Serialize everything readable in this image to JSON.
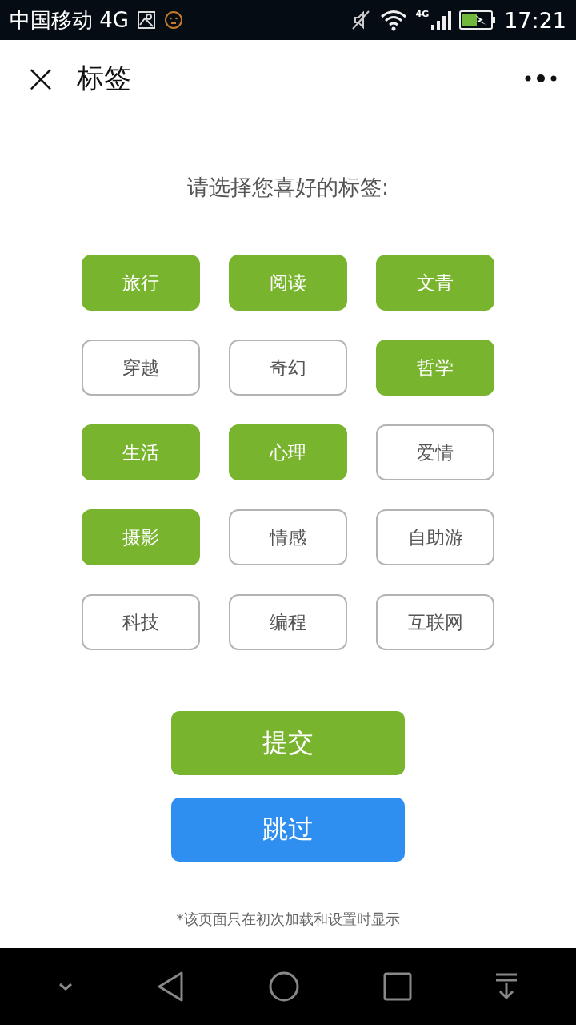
{
  "status_bar": {
    "carrier": "中国移动 4G",
    "network_badge": "4G",
    "time": "17:21"
  },
  "header": {
    "title": "标签",
    "close_icon": "×"
  },
  "prompt": "请选择您喜好的标签:",
  "tags": [
    {
      "label": "旅行",
      "selected": true
    },
    {
      "label": "阅读",
      "selected": true
    },
    {
      "label": "文青",
      "selected": true
    },
    {
      "label": "穿越",
      "selected": false
    },
    {
      "label": "奇幻",
      "selected": false
    },
    {
      "label": "哲学",
      "selected": true
    },
    {
      "label": "生活",
      "selected": true
    },
    {
      "label": "心理",
      "selected": true
    },
    {
      "label": "爱情",
      "selected": false
    },
    {
      "label": "摄影",
      "selected": true
    },
    {
      "label": "情感",
      "selected": false
    },
    {
      "label": "自助游",
      "selected": false
    },
    {
      "label": "科技",
      "selected": false
    },
    {
      "label": "编程",
      "selected": false
    },
    {
      "label": "互联网",
      "selected": false
    }
  ],
  "buttons": [
    {
      "label": "提交",
      "kind": "submit"
    },
    {
      "label": "跳过",
      "kind": "skip"
    }
  ],
  "note": "*该页面只在初次加载和设置时显示"
}
